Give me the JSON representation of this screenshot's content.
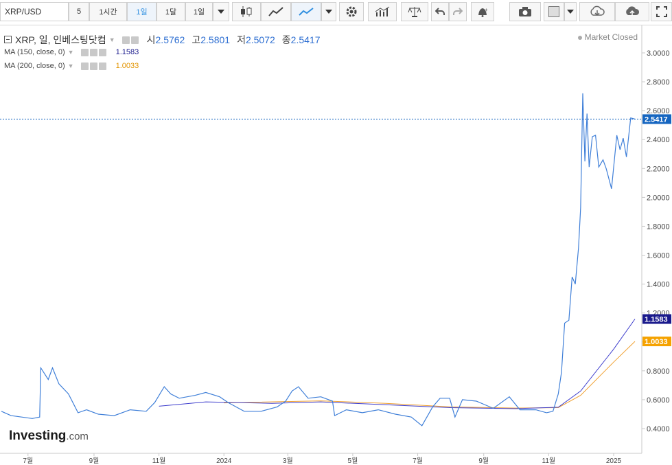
{
  "toolbar": {
    "symbol": "XRP/USD",
    "interval_min": "5",
    "interval_hour": "1시간",
    "interval_day": "1일",
    "interval_month": "1달",
    "interval_select": "1일"
  },
  "legend": {
    "title": "XRP, 일, 인베스팅닷컴",
    "open_label": "시",
    "open": "2.5762",
    "high_label": "고",
    "high": "2.5801",
    "low_label": "저",
    "low": "2.5072",
    "close_label": "종",
    "close": "2.5417",
    "ma150_label": "MA (150, close, 0)",
    "ma150_value": "1.1583",
    "ma200_label": "MA (200, close, 0)",
    "ma200_value": "1.0033"
  },
  "status": "Market Closed",
  "brand": {
    "name": "Investing",
    "suffix": ".com"
  },
  "colors": {
    "price": "#3f7fd8",
    "ma150": "#3c3ccc",
    "ma200": "#f0a030",
    "current_label": "#1565c0",
    "ma150_label": "#1a1a8c",
    "ma200_label": "#f5a200"
  },
  "chart_data": {
    "type": "line",
    "ylim": [
      0.3,
      3.1
    ],
    "y_ticks": [
      "0.4000",
      "0.6000",
      "0.8000",
      "1.0000",
      "1.2000",
      "1.4000",
      "1.6000",
      "1.8000",
      "2.0000",
      "2.2000",
      "2.4000",
      "2.6000",
      "2.8000",
      "3.0000"
    ],
    "x_range": [
      "2023-06-06",
      "2025-01-21"
    ],
    "x_ticks": [
      {
        "label": "7월",
        "date": "2023-07-01"
      },
      {
        "label": "9월",
        "date": "2023-09-01"
      },
      {
        "label": "11월",
        "date": "2023-11-01"
      },
      {
        "label": "2024",
        "date": "2024-01-01"
      },
      {
        "label": "3월",
        "date": "2024-03-01"
      },
      {
        "label": "5월",
        "date": "2024-05-01"
      },
      {
        "label": "7월",
        "date": "2024-07-01"
      },
      {
        "label": "9월",
        "date": "2024-09-01"
      },
      {
        "label": "11월",
        "date": "2024-11-01"
      },
      {
        "label": "2025",
        "date": "2025-01-01"
      }
    ],
    "last_price": 2.5417,
    "series": [
      {
        "key": "price",
        "points": [
          [
            "2023-06-06",
            0.52
          ],
          [
            "2023-06-15",
            0.49
          ],
          [
            "2023-06-25",
            0.48
          ],
          [
            "2023-07-05",
            0.47
          ],
          [
            "2023-07-12",
            0.48
          ],
          [
            "2023-07-13",
            0.82
          ],
          [
            "2023-07-20",
            0.74
          ],
          [
            "2023-07-24",
            0.82
          ],
          [
            "2023-07-30",
            0.71
          ],
          [
            "2023-08-08",
            0.64
          ],
          [
            "2023-08-17",
            0.51
          ],
          [
            "2023-08-25",
            0.53
          ],
          [
            "2023-09-05",
            0.5
          ],
          [
            "2023-09-20",
            0.49
          ],
          [
            "2023-10-05",
            0.53
          ],
          [
            "2023-10-20",
            0.52
          ],
          [
            "2023-10-28",
            0.58
          ],
          [
            "2023-11-06",
            0.69
          ],
          [
            "2023-11-12",
            0.64
          ],
          [
            "2023-11-20",
            0.61
          ],
          [
            "2023-12-05",
            0.63
          ],
          [
            "2023-12-15",
            0.65
          ],
          [
            "2023-12-28",
            0.62
          ],
          [
            "2024-01-05",
            0.58
          ],
          [
            "2024-01-20",
            0.52
          ],
          [
            "2024-02-05",
            0.52
          ],
          [
            "2024-02-20",
            0.55
          ],
          [
            "2024-02-28",
            0.59
          ],
          [
            "2024-03-05",
            0.66
          ],
          [
            "2024-03-11",
            0.69
          ],
          [
            "2024-03-20",
            0.61
          ],
          [
            "2024-04-01",
            0.62
          ],
          [
            "2024-04-12",
            0.59
          ],
          [
            "2024-04-14",
            0.49
          ],
          [
            "2024-04-25",
            0.53
          ],
          [
            "2024-05-10",
            0.51
          ],
          [
            "2024-05-25",
            0.53
          ],
          [
            "2024-06-10",
            0.5
          ],
          [
            "2024-06-25",
            0.48
          ],
          [
            "2024-07-05",
            0.42
          ],
          [
            "2024-07-15",
            0.55
          ],
          [
            "2024-07-22",
            0.61
          ],
          [
            "2024-07-31",
            0.61
          ],
          [
            "2024-08-05",
            0.48
          ],
          [
            "2024-08-12",
            0.6
          ],
          [
            "2024-08-25",
            0.59
          ],
          [
            "2024-09-10",
            0.54
          ],
          [
            "2024-09-25",
            0.62
          ],
          [
            "2024-10-05",
            0.53
          ],
          [
            "2024-10-20",
            0.53
          ],
          [
            "2024-10-30",
            0.51
          ],
          [
            "2024-11-05",
            0.52
          ],
          [
            "2024-11-10",
            0.64
          ],
          [
            "2024-11-13",
            0.79
          ],
          [
            "2024-11-16",
            1.13
          ],
          [
            "2024-11-20",
            1.15
          ],
          [
            "2024-11-23",
            1.45
          ],
          [
            "2024-11-26",
            1.4
          ],
          [
            "2024-11-29",
            1.65
          ],
          [
            "2024-12-01",
            1.93
          ],
          [
            "2024-12-03",
            2.72
          ],
          [
            "2024-12-05",
            2.25
          ],
          [
            "2024-12-07",
            2.58
          ],
          [
            "2024-12-09",
            2.21
          ],
          [
            "2024-12-12",
            2.42
          ],
          [
            "2024-12-15",
            2.43
          ],
          [
            "2024-12-18",
            2.21
          ],
          [
            "2024-12-22",
            2.26
          ],
          [
            "2024-12-25",
            2.2
          ],
          [
            "2024-12-30",
            2.06
          ],
          [
            "2025-01-04",
            2.43
          ],
          [
            "2025-01-07",
            2.33
          ],
          [
            "2025-01-10",
            2.41
          ],
          [
            "2025-01-13",
            2.28
          ],
          [
            "2025-01-17",
            2.55
          ],
          [
            "2025-01-21",
            2.5417
          ]
        ]
      },
      {
        "key": "ma150",
        "points": [
          [
            "2023-11-01",
            0.555
          ],
          [
            "2023-12-15",
            0.585
          ],
          [
            "2024-02-15",
            0.575
          ],
          [
            "2024-04-01",
            0.585
          ],
          [
            "2024-06-01",
            0.565
          ],
          [
            "2024-08-01",
            0.545
          ],
          [
            "2024-10-01",
            0.538
          ],
          [
            "2024-11-10",
            0.548
          ],
          [
            "2024-12-01",
            0.66
          ],
          [
            "2025-01-01",
            0.95
          ],
          [
            "2025-01-21",
            1.1583
          ]
        ]
      },
      {
        "key": "ma200",
        "points": [
          [
            "2024-01-01",
            0.578
          ],
          [
            "2024-04-01",
            0.592
          ],
          [
            "2024-06-01",
            0.575
          ],
          [
            "2024-08-01",
            0.55
          ],
          [
            "2024-10-01",
            0.542
          ],
          [
            "2024-11-10",
            0.545
          ],
          [
            "2024-12-01",
            0.63
          ],
          [
            "2025-01-01",
            0.86
          ],
          [
            "2025-01-21",
            1.0033
          ]
        ]
      }
    ]
  }
}
